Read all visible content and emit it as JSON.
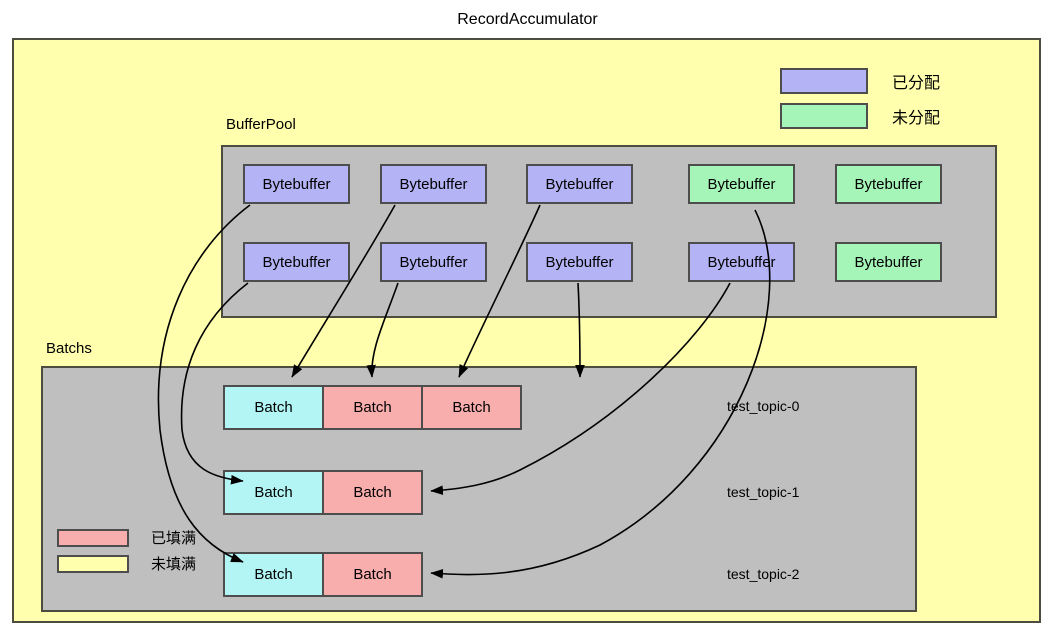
{
  "title": "RecordAccumulator",
  "groups": {
    "bufferpool": {
      "label": "BufferPool"
    },
    "batchs": {
      "label": "Batchs"
    }
  },
  "legend_allocation": {
    "items": [
      {
        "label": "已分配",
        "color": "#b3b3f5",
        "state": "allocated"
      },
      {
        "label": "未分配",
        "color": "#a6f5b8",
        "state": "free"
      }
    ]
  },
  "legend_fill": {
    "items": [
      {
        "label": "已填满",
        "color": "#f9aeae",
        "state": "full"
      },
      {
        "label": "未填满",
        "color": "#ffffae",
        "state": "not-full"
      }
    ]
  },
  "bufferpool": {
    "rows": [
      [
        {
          "label": "Bytebuffer",
          "state": "allocated"
        },
        {
          "label": "Bytebuffer",
          "state": "allocated"
        },
        {
          "label": "Bytebuffer",
          "state": "allocated"
        },
        {
          "label": "Bytebuffer",
          "state": "free"
        },
        {
          "label": "Bytebuffer",
          "state": "free"
        }
      ],
      [
        {
          "label": "Bytebuffer",
          "state": "allocated"
        },
        {
          "label": "Bytebuffer",
          "state": "allocated"
        },
        {
          "label": "Bytebuffer",
          "state": "allocated"
        },
        {
          "label": "Bytebuffer",
          "state": "allocated"
        },
        {
          "label": "Bytebuffer",
          "state": "free"
        }
      ]
    ]
  },
  "batchs": {
    "partitions": [
      {
        "topic": "test_topic-0",
        "batches": [
          {
            "label": "Batch",
            "state": "not-full"
          },
          {
            "label": "Batch",
            "state": "full"
          },
          {
            "label": "Batch",
            "state": "full"
          }
        ]
      },
      {
        "topic": "test_topic-1",
        "batches": [
          {
            "label": "Batch",
            "state": "not-full"
          },
          {
            "label": "Batch",
            "state": "full"
          }
        ]
      },
      {
        "topic": "test_topic-2",
        "batches": [
          {
            "label": "Batch",
            "state": "not-full"
          },
          {
            "label": "Batch",
            "state": "full"
          }
        ]
      }
    ]
  },
  "colors": {
    "panel_bg": "#ffffae",
    "group_bg": "#bfbfbf",
    "allocated": "#b3b3f5",
    "free": "#a6f5b8",
    "batch_not_full": "#b3f5f5",
    "batch_full": "#f9aeae",
    "border": "#4d4d3f",
    "arrow": "#000000"
  }
}
